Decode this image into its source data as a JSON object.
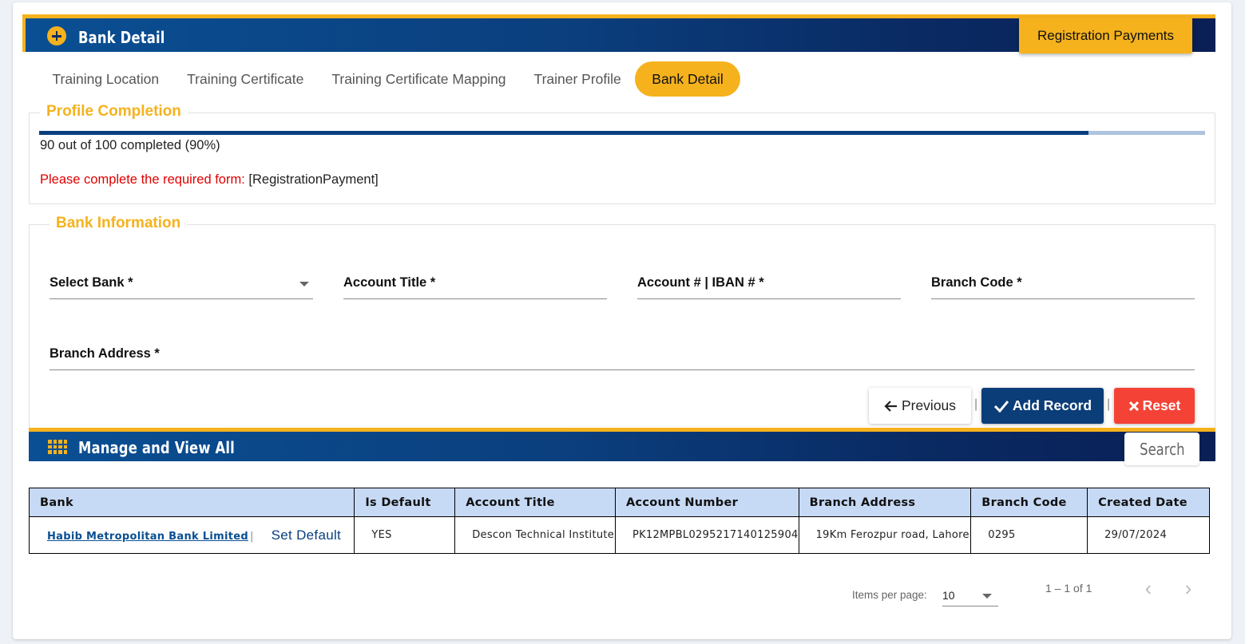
{
  "header": {
    "title": "Bank Detail",
    "registration_button": "Registration Payments"
  },
  "tabs": [
    {
      "label": "Training Location",
      "active": false
    },
    {
      "label": "Training Certificate",
      "active": false
    },
    {
      "label": "Training Certificate Mapping",
      "active": false
    },
    {
      "label": "Trainer Profile",
      "active": false
    },
    {
      "label": "Bank Detail",
      "active": true
    }
  ],
  "profile": {
    "legend": "Profile Completion",
    "progress_percent": 90,
    "progress_text": "90 out of 100 completed (90%)",
    "required_label": "Please complete the required form:",
    "required_value": "[RegistrationPayment]"
  },
  "bank_info": {
    "legend": "Bank Information",
    "select_bank_label": "Select Bank *",
    "account_title_label": "Account Title *",
    "account_iban_label": "Account # | IBAN # *",
    "branch_code_label": "Branch Code *",
    "branch_address_label": "Branch Address *"
  },
  "actions": {
    "previous_label": "Previous",
    "add_label": "Add Record",
    "reset_label": "Reset",
    "separator": "|"
  },
  "manage": {
    "title": "Manage and View All",
    "search_label": "Search"
  },
  "table": {
    "headers": [
      "Bank",
      "Is Default",
      "Account Title",
      "Account Number",
      "Branch Address",
      "Branch Code",
      "Created Date"
    ],
    "rows": [
      {
        "bank": "Habib Metropolitan Bank Limited",
        "pipe": "|",
        "set_default": "Set Default",
        "is_default": "YES",
        "account_title": "Descon Technical Institute",
        "account_number": "PK12MPBL0295217140125904",
        "branch_address": "19Km Ferozpur road, Lahore",
        "branch_code": "0295",
        "created_date": "29/07/2024"
      }
    ]
  },
  "paginator": {
    "items_per_page_label": "Items per page:",
    "items_per_page_value": "10",
    "range": "1 – 1 of 1",
    "prev_icon": "chevron-left-icon",
    "next_icon": "chevron-right-icon"
  },
  "colors": {
    "accent": "#f5b21d",
    "primary": "#0b3d78",
    "danger": "#f44336",
    "table_header": "#c6d9f5"
  }
}
